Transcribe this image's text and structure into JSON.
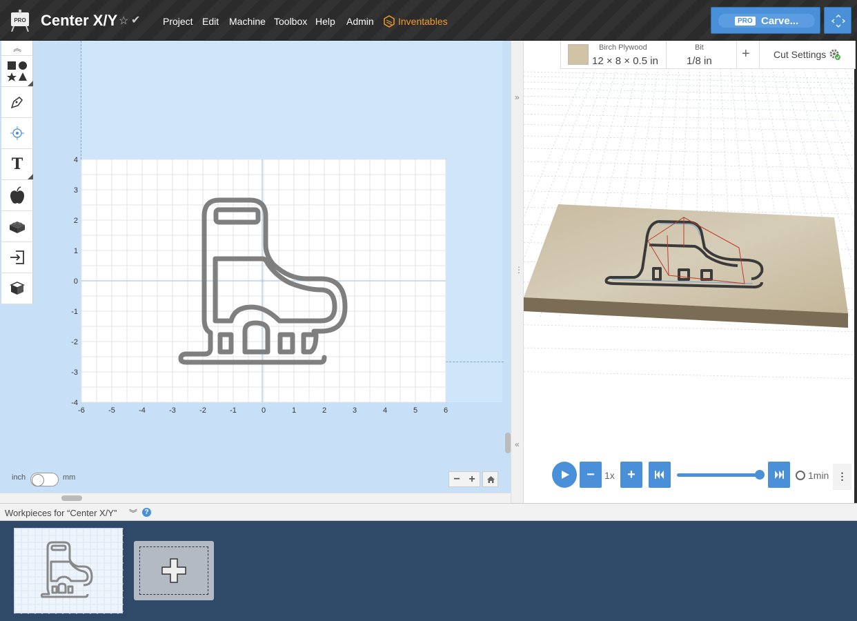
{
  "app": {
    "logo_badge": "PRO",
    "title": "Center X/Y"
  },
  "menu": {
    "items": [
      "Project",
      "Edit",
      "Machine",
      "Toolbox",
      "Help",
      "Admin"
    ],
    "brand_link": "Inventables"
  },
  "header": {
    "pro_badge": "PRO",
    "carve_label": "Carve..."
  },
  "toolbar": {
    "tools": [
      "shapes-icon",
      "pen-icon",
      "target-icon",
      "text-icon",
      "apple-icon",
      "bricks-icon",
      "import-icon",
      "cube-icon"
    ]
  },
  "canvas": {
    "x_ticks": [
      "-6",
      "-5",
      "-4",
      "-3",
      "-2",
      "-1",
      "0",
      "1",
      "2",
      "3",
      "4",
      "5",
      "6"
    ],
    "y_ticks": [
      "4",
      "3",
      "2",
      "1",
      "0",
      "-1",
      "-2",
      "-3",
      "-4"
    ],
    "unit_left": "inch",
    "unit_right": "mm"
  },
  "material": {
    "name": "Birch Plywood",
    "dims": "12 × 8 × 0.5 in",
    "bit_label": "Bit",
    "bit_value": "1/8 in",
    "cut_settings": "Cut Settings"
  },
  "playback": {
    "speed": "1x",
    "time": "1min",
    "progress": 1.0
  },
  "workpieces": {
    "title": "Workpieces for “Center X/Y”",
    "help": "?"
  },
  "colors": {
    "accent": "#4a90d9",
    "brand_orange": "#f39c27",
    "canvas_bg": "#c7e0f7",
    "workpiece_panel": "#2e4a68"
  }
}
